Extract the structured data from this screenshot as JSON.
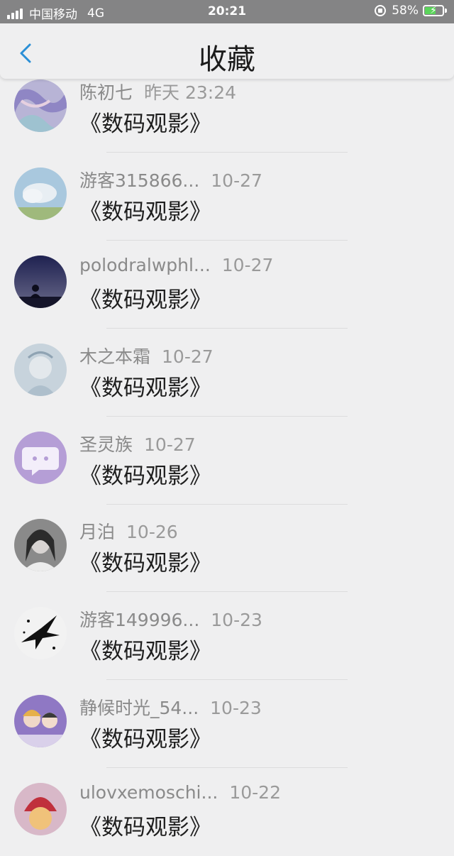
{
  "status_bar": {
    "carrier": "中国移动",
    "network": "4G",
    "time": "20:21",
    "battery": "58%"
  },
  "nav": {
    "title": "收藏"
  },
  "items": [
    {
      "user": "陈初七",
      "date": "昨天 23:24",
      "title": "《数码观影》"
    },
    {
      "user": "游客315866...",
      "date": "10-27",
      "title": "《数码观影》"
    },
    {
      "user": "polodralwphl...",
      "date": "10-27",
      "title": "《数码观影》"
    },
    {
      "user": "木之本霜",
      "date": "10-27",
      "title": "《数码观影》"
    },
    {
      "user": "圣灵族",
      "date": "10-27",
      "title": "《数码观影》"
    },
    {
      "user": "月泊",
      "date": "10-26",
      "title": "《数码观影》"
    },
    {
      "user": "游客149996...",
      "date": "10-23",
      "title": "《数码观影》"
    },
    {
      "user": "静候时光_54...",
      "date": "10-23",
      "title": "《数码观影》"
    },
    {
      "user": "ulovxemoschi...",
      "date": "10-22",
      "title": "《数码观影》"
    }
  ],
  "colors": {
    "background": "#efeff0",
    "status_bar": "#848485",
    "accent_back": "#2a8fd6"
  }
}
